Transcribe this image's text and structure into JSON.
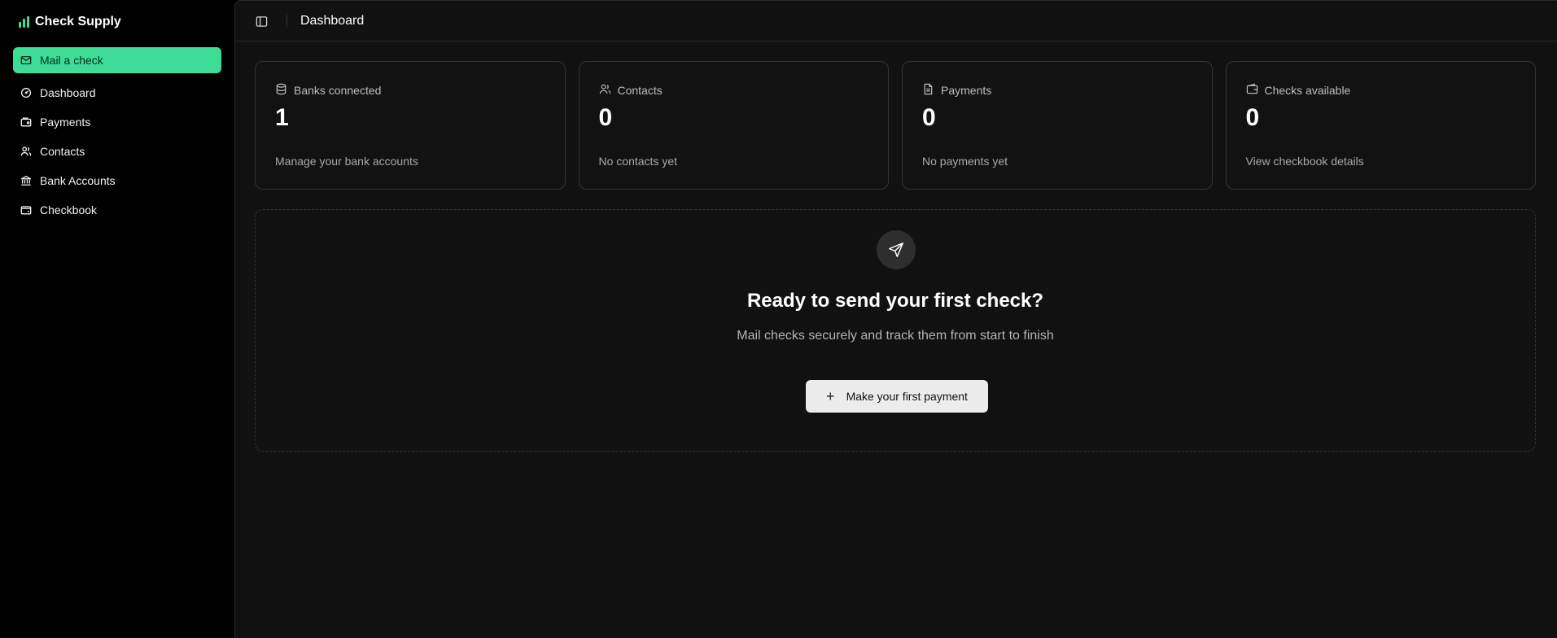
{
  "brand": {
    "name": "Check Supply",
    "accent": "#3ddc97"
  },
  "sidebar": {
    "primary_action": {
      "label": "Mail a check",
      "icon": "mail-icon"
    },
    "items": [
      {
        "label": "Dashboard",
        "icon": "gauge-icon"
      },
      {
        "label": "Payments",
        "icon": "wallet-icon"
      },
      {
        "label": "Contacts",
        "icon": "users-icon"
      },
      {
        "label": "Bank Accounts",
        "icon": "bank-icon"
      },
      {
        "label": "Checkbook",
        "icon": "checkbook-icon"
      }
    ]
  },
  "header": {
    "title": "Dashboard",
    "toggle_icon": "sidebar-toggle-icon"
  },
  "stats": [
    {
      "label": "Banks connected",
      "value": "1",
      "footer": "Manage your bank accounts",
      "icon": "database-icon"
    },
    {
      "label": "Contacts",
      "value": "0",
      "footer": "No contacts yet",
      "icon": "users-icon"
    },
    {
      "label": "Payments",
      "value": "0",
      "footer": "No payments yet",
      "icon": "document-icon"
    },
    {
      "label": "Checks available",
      "value": "0",
      "footer": "View checkbook details",
      "icon": "wallet-icon"
    }
  ],
  "empty_state": {
    "icon": "send-icon",
    "title": "Ready to send your first check?",
    "subtitle": "Mail checks securely and track them from start to finish",
    "cta_label": "Make your first payment",
    "cta_icon": "plus-icon"
  }
}
